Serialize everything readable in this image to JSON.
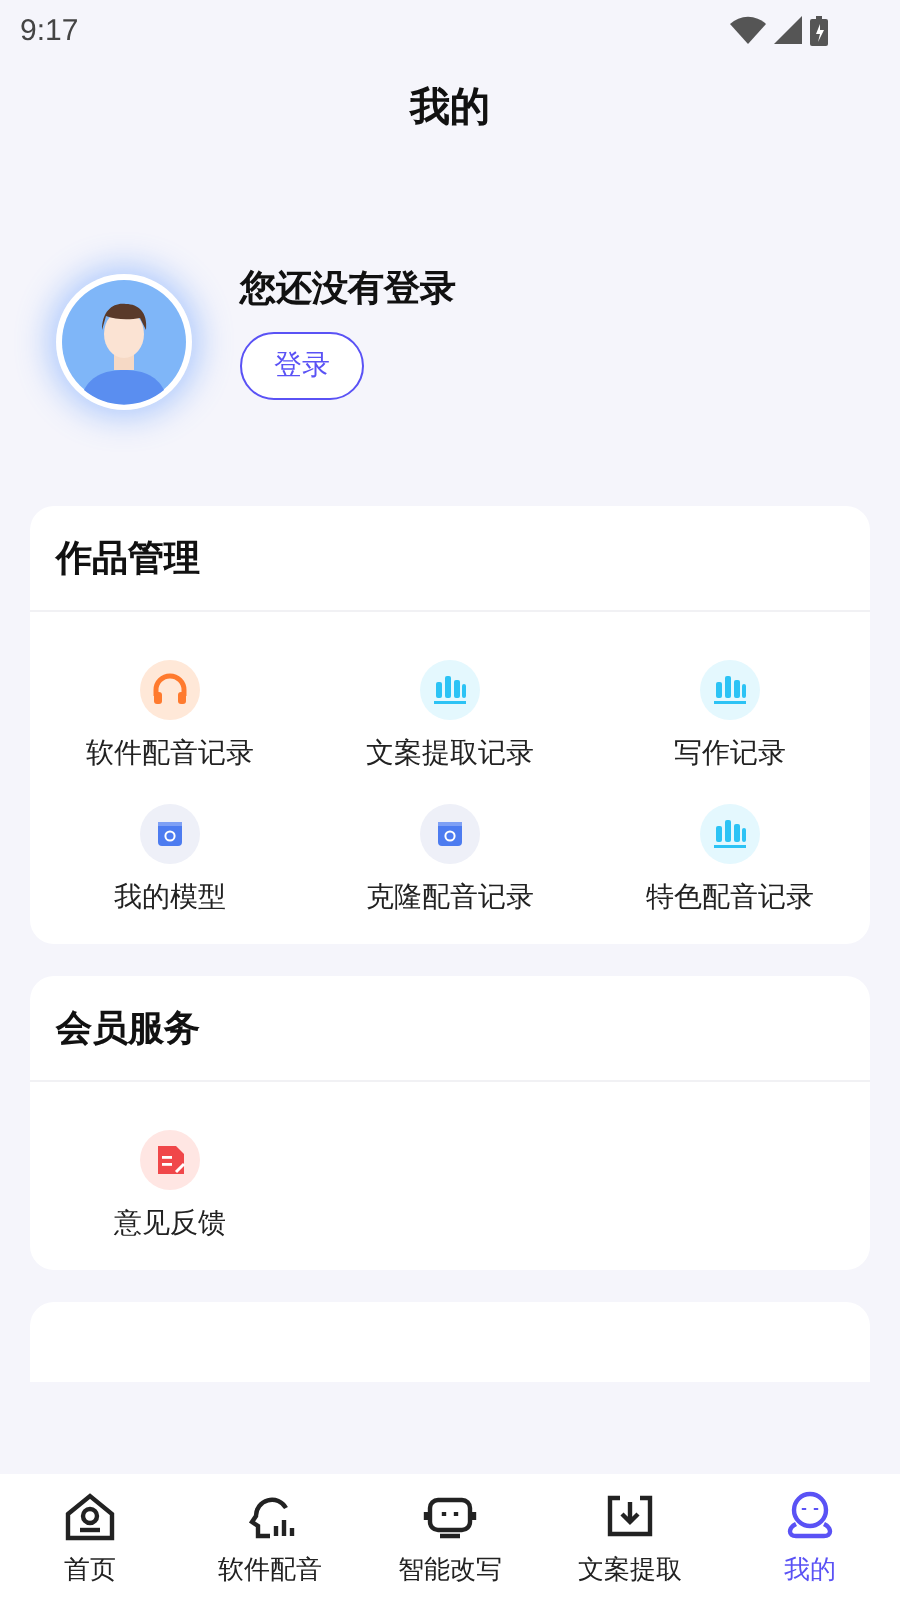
{
  "status_bar": {
    "time": "9:17"
  },
  "header": {
    "title": "我的"
  },
  "profile": {
    "name": "您还没有登录",
    "login_button": "登录"
  },
  "sections": [
    {
      "title": "作品管理",
      "items": [
        {
          "label": "软件配音记录",
          "kind": "headphones"
        },
        {
          "label": "文案提取记录",
          "kind": "bars"
        },
        {
          "label": "写作记录",
          "kind": "bars"
        },
        {
          "label": "我的模型",
          "kind": "model"
        },
        {
          "label": "克隆配音记录",
          "kind": "model"
        },
        {
          "label": "特色配音记录",
          "kind": "bars"
        }
      ]
    },
    {
      "title": "会员服务",
      "items": [
        {
          "label": "意见反馈",
          "kind": "feedback"
        }
      ]
    }
  ],
  "bottom_nav": [
    {
      "label": "首页",
      "kind": "home",
      "selected": false
    },
    {
      "label": "软件配音",
      "kind": "voice",
      "selected": false
    },
    {
      "label": "智能改写",
      "kind": "robot",
      "selected": false
    },
    {
      "label": "文案提取",
      "kind": "download",
      "selected": false
    },
    {
      "label": "我的",
      "kind": "person",
      "selected": true
    }
  ]
}
